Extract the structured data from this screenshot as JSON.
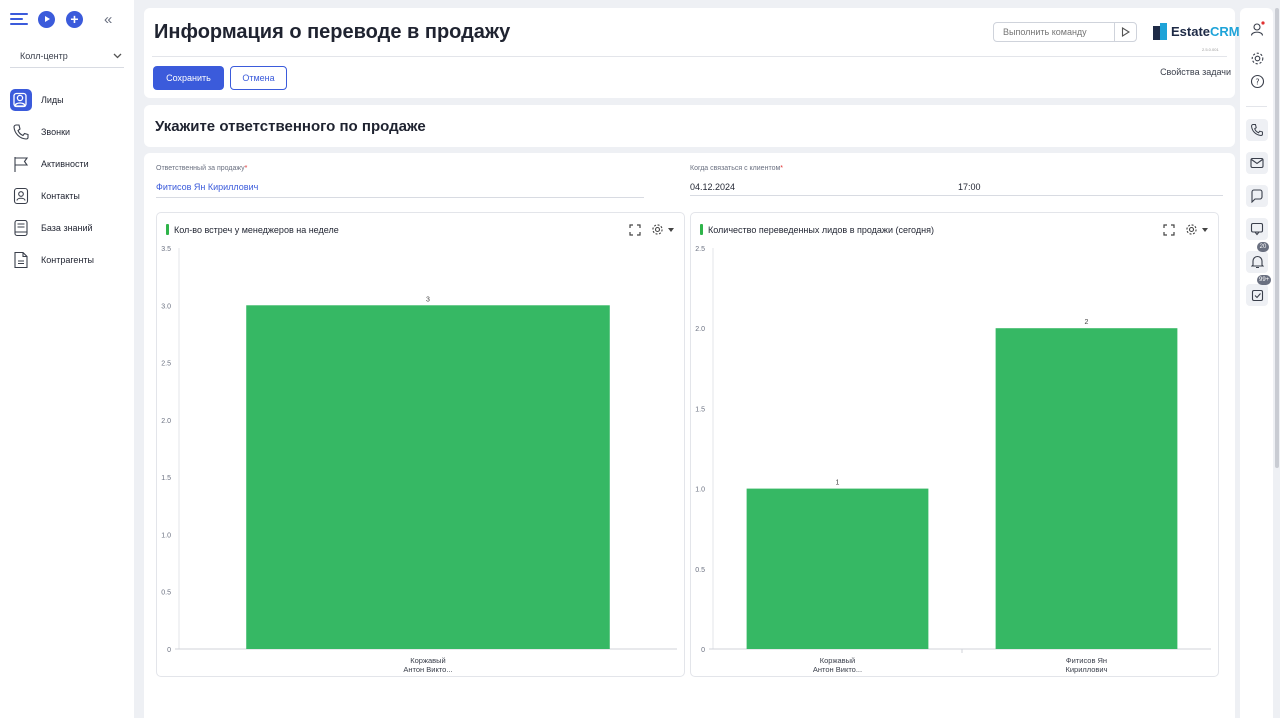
{
  "sidebar": {
    "workspace": "Колл-центр",
    "items": [
      {
        "label": "Лиды",
        "icon": "leads-icon"
      },
      {
        "label": "Звонки",
        "icon": "phone-icon"
      },
      {
        "label": "Активности",
        "icon": "flag-icon"
      },
      {
        "label": "Контакты",
        "icon": "contact-icon"
      },
      {
        "label": "База знаний",
        "icon": "book-icon"
      },
      {
        "label": "Контрагенты",
        "icon": "document-icon"
      }
    ]
  },
  "header": {
    "title": "Информация о переводе в продажу",
    "command_placeholder": "Выполнить команду",
    "logo_estate": "Estate",
    "logo_crm": "CRM",
    "logo_version": "2.5.0.001",
    "save_label": "Сохранить",
    "cancel_label": "Отмена",
    "task_props": "Свойства задачи"
  },
  "section": {
    "title": "Укажите ответственного по продаже"
  },
  "form": {
    "responsible_label": "Ответственный за продажу",
    "responsible_value": "Фитисов Ян Кириллович",
    "contact_label": "Когда связаться с клиентом",
    "contact_date": "04.12.2024",
    "contact_time": "17:00",
    "required_mark": "*"
  },
  "colors": {
    "accent": "#3b5bdb",
    "bar": "#36b864",
    "required": "#e03131"
  },
  "chart_data": [
    {
      "type": "bar",
      "title": "Кол-во встреч у менеджеров на неделе",
      "categories": [
        [
          "Коржавый",
          "Антон Викто..."
        ]
      ],
      "values": [
        3
      ],
      "value_labels": [
        "3"
      ],
      "ylim": [
        0,
        3.5
      ],
      "yticks": [
        0,
        0.5,
        1.0,
        1.5,
        2.0,
        2.5,
        3.0,
        3.5
      ],
      "ytick_labels": [
        "0",
        "0.5",
        "1.0",
        "1.5",
        "2.0",
        "2.5",
        "3.0",
        "3.5"
      ],
      "grid": false,
      "legend": "none"
    },
    {
      "type": "bar",
      "title": "Количество переведенных лидов в продажи (сегодня)",
      "categories": [
        [
          "Коржавый",
          "Антон Викто..."
        ],
        [
          "Фитисов Ян",
          "Кириллович"
        ]
      ],
      "values": [
        1,
        2
      ],
      "value_labels": [
        "1",
        "2"
      ],
      "ylim": [
        0,
        2.5
      ],
      "yticks": [
        0,
        0.5,
        1.0,
        1.5,
        2.0,
        2.5
      ],
      "ytick_labels": [
        "0",
        "0.5",
        "1.0",
        "1.5",
        "2.0",
        "2.5"
      ],
      "grid": false,
      "legend": "none"
    }
  ],
  "rail": {
    "notifications_badge": "20",
    "tasks_badge": "99+"
  }
}
